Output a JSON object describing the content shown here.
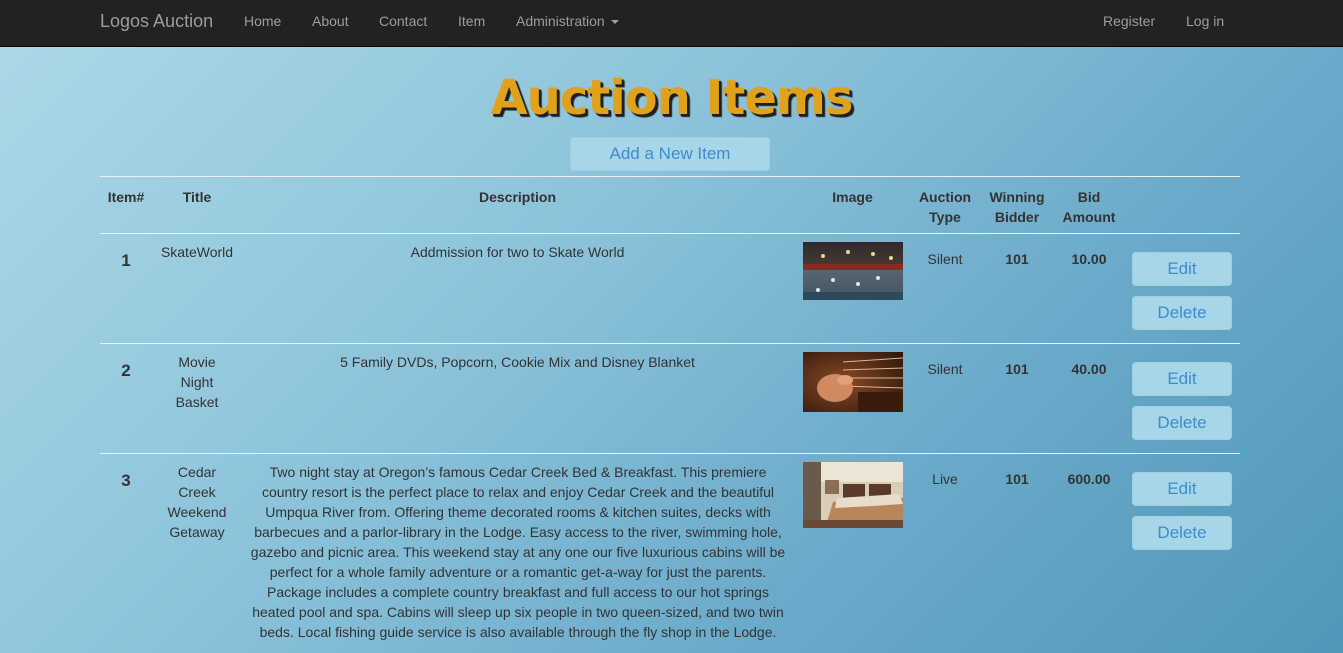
{
  "navbar": {
    "brand": "Logos Auction",
    "links": [
      "Home",
      "About",
      "Contact",
      "Item",
      "Administration"
    ],
    "right_links": [
      "Register",
      "Log in"
    ]
  },
  "page": {
    "title": "Auction Items",
    "add_button": "Add a New Item"
  },
  "table": {
    "headers": {
      "item_no": "Item#",
      "title": "Title",
      "description": "Description",
      "image": "Image",
      "auction_type_1": "Auction",
      "auction_type_2": "Type",
      "winning_bidder_1": "Winning",
      "winning_bidder_2": "Bidder",
      "bid_amount_1": "Bid",
      "bid_amount_2": "Amount"
    },
    "rows": [
      {
        "number": "1",
        "title": "SkateWorld",
        "description": "Addmission for two to Skate World",
        "image": "skating-rink-photo",
        "auction_type": "Silent",
        "winning_bidder": "101",
        "bid_amount": "10.00",
        "edit": "Edit",
        "delete": "Delete"
      },
      {
        "number": "2",
        "title": "Movie Night Basket",
        "description": "5 Family DVDs, Popcorn, Cookie Mix and Disney Blanket",
        "image": "guitar-photo",
        "auction_type": "Silent",
        "winning_bidder": "101",
        "bid_amount": "40.00",
        "edit": "Edit",
        "delete": "Delete"
      },
      {
        "number": "3",
        "title": "Cedar Creek Weekend Getaway",
        "description": "Two night stay at Oregon’s famous Cedar Creek Bed & Breakfast. This premiere country resort is the perfect place to relax and enjoy Cedar Creek and the beautiful Umpqua River from. Offering theme decorated rooms & kitchen suites, decks with barbecues and a parlor-library in the Lodge. Easy access to the river, swimming hole, gazebo and picnic area. This weekend stay at any one our five luxurious cabins will be perfect for a whole family adventure or a romantic get-a-way for just the parents. Package includes a complete country breakfast and full access to our hot springs heated pool and spa. Cabins will sleep up six people in two queen-sized, and two twin beds. Local fishing guide service is also available through the fly shop in the Lodge.",
        "image": "hotel-room-photo",
        "auction_type": "Live",
        "winning_bidder": "101",
        "bid_amount": "600.00",
        "edit": "Edit",
        "delete": "Delete"
      }
    ]
  },
  "colors": {
    "navbar": "#222222",
    "title": "#e0a21c",
    "button_bg": "#a7d6e8",
    "button_text": "#3f8ccb"
  }
}
